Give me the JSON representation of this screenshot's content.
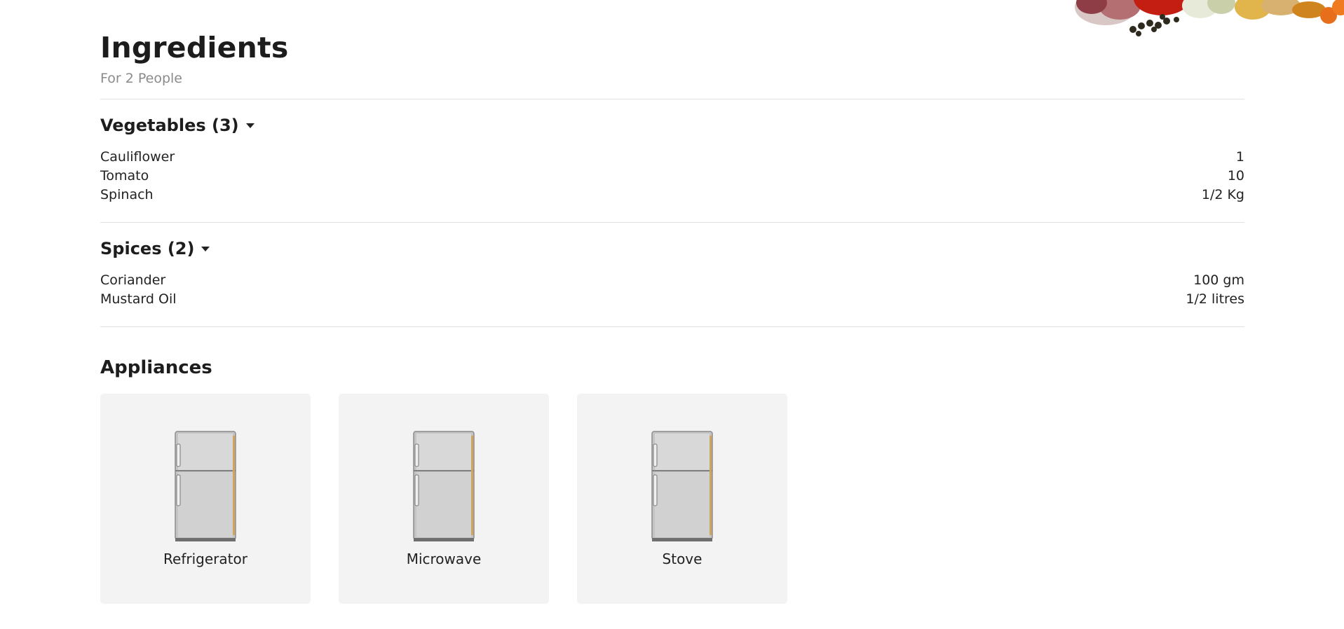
{
  "header": {
    "title": "Ingredients",
    "servings": "For 2 People"
  },
  "sections": [
    {
      "title": "Vegetables (3)",
      "items": [
        {
          "name": "Cauliflower",
          "qty": "1"
        },
        {
          "name": "Tomato",
          "qty": "10"
        },
        {
          "name": "Spinach",
          "qty": "1/2 Kg"
        }
      ]
    },
    {
      "title": "Spices (2)",
      "items": [
        {
          "name": "Coriander",
          "qty": "100 gm"
        },
        {
          "name": "Mustard Oil",
          "qty": "1/2 litres"
        }
      ]
    }
  ],
  "appliances": {
    "title": "Appliances",
    "items": [
      {
        "label": "Refrigerator",
        "icon": "refrigerator-icon"
      },
      {
        "label": "Microwave",
        "icon": "refrigerator-icon"
      },
      {
        "label": "Stove",
        "icon": "refrigerator-icon"
      }
    ]
  },
  "colors": {
    "card_bg": "#f3f3f3",
    "divider": "#e2e2e2",
    "muted_text": "#8b8b8b"
  }
}
